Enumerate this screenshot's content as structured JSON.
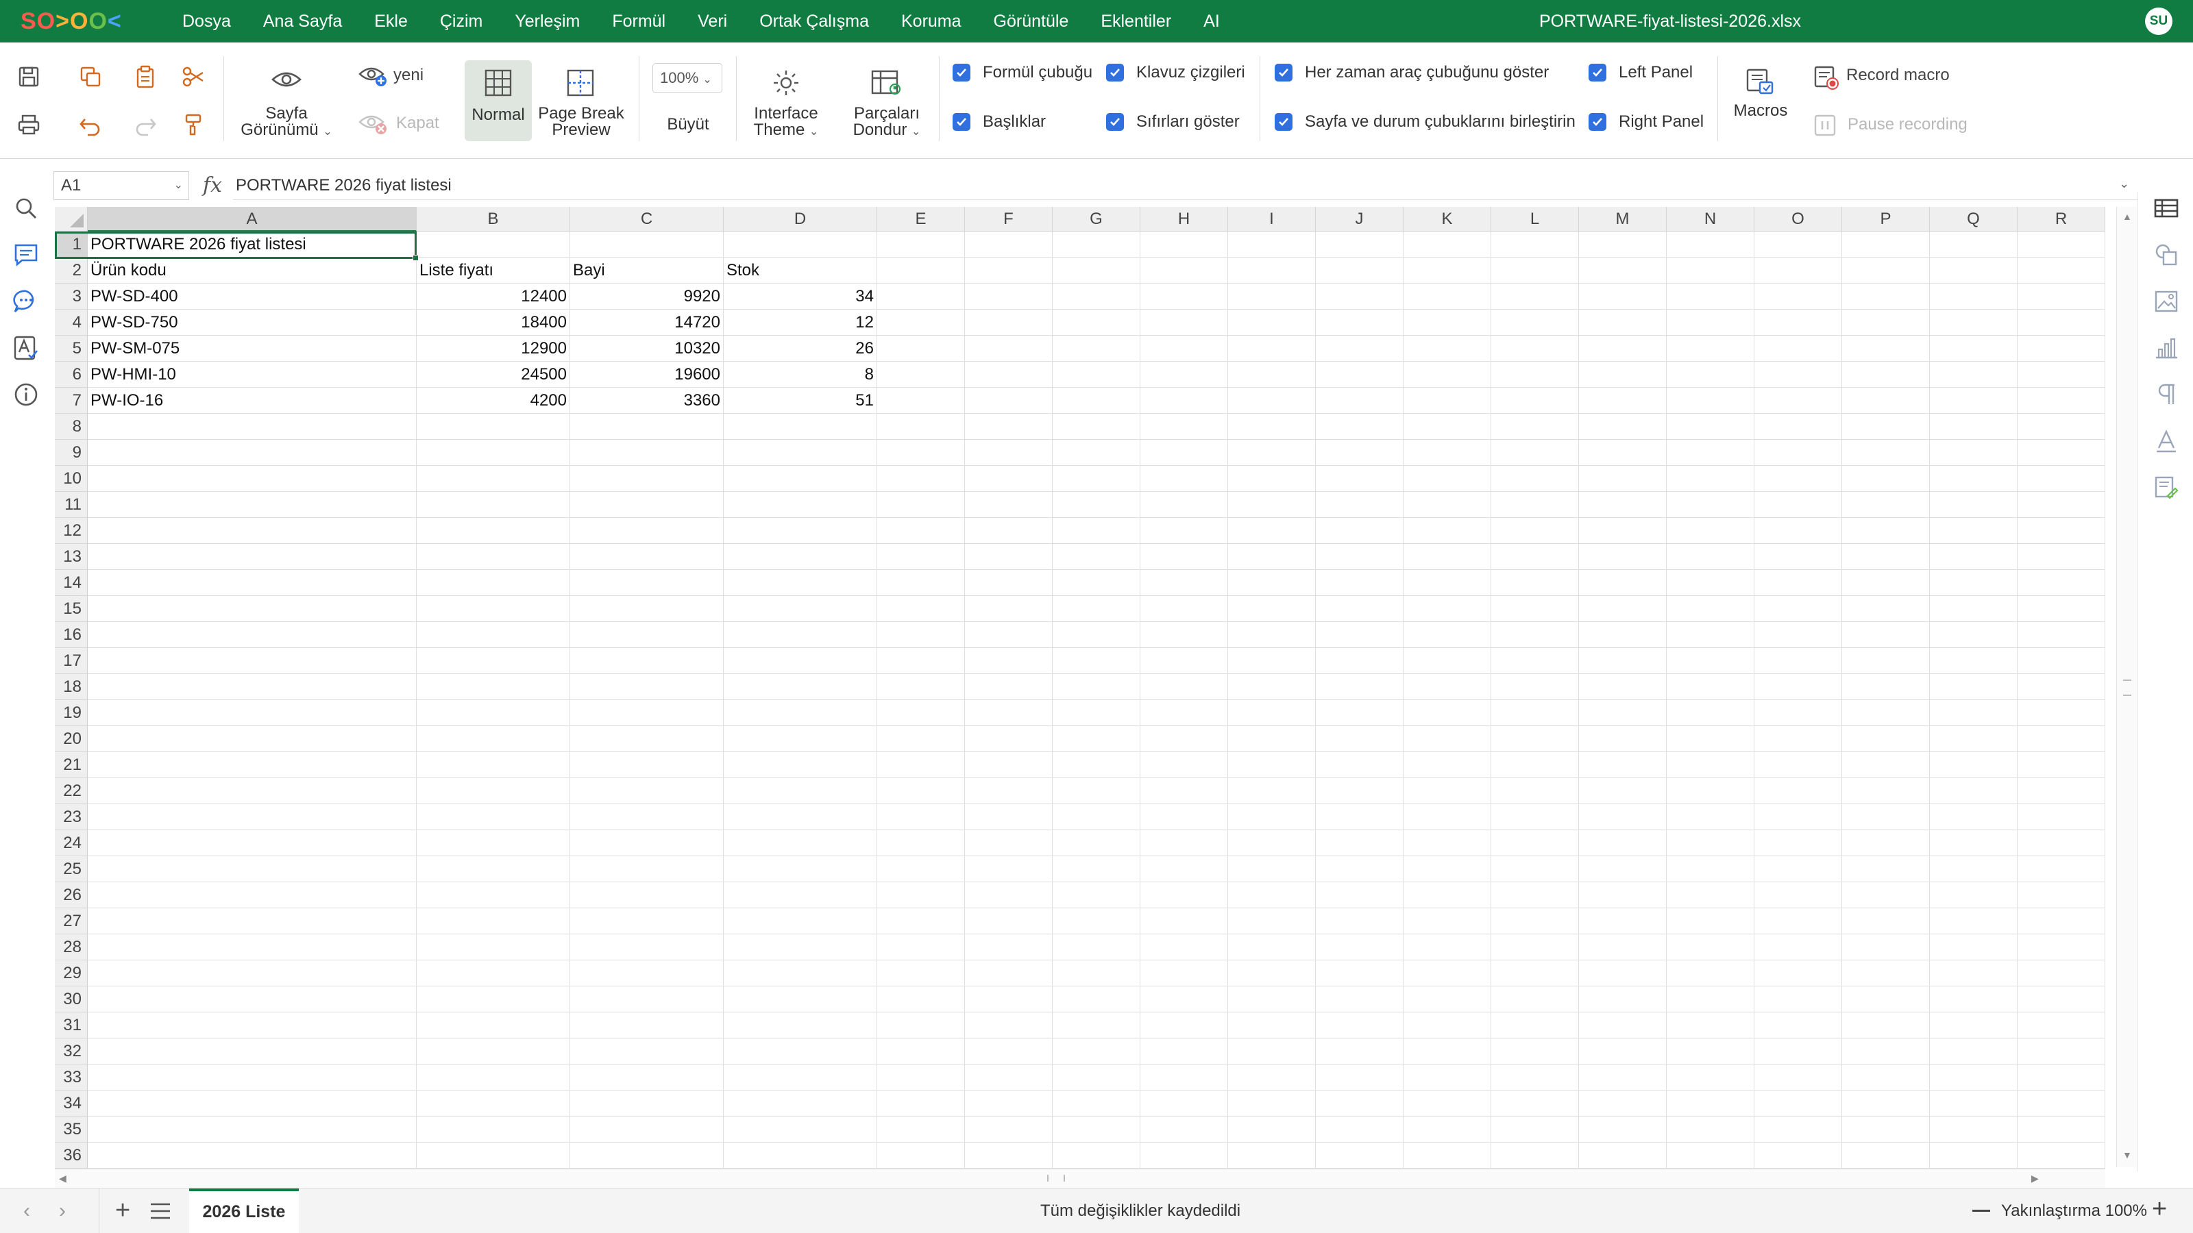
{
  "app": {
    "logo": "SO>OO<",
    "avatar_initials": "SU"
  },
  "window": {
    "title": "PORTWARE-fiyat-listesi-2026.xlsx"
  },
  "menu": [
    "Dosya",
    "Ana Sayfa",
    "Ekle",
    "Çizim",
    "Yerleşim",
    "Formül",
    "Veri",
    "Ortak Çalışma",
    "Koruma",
    "Görüntüle",
    "Eklentiler",
    "AI"
  ],
  "ribbon": {
    "sheet_view_label_1": "Sayfa",
    "sheet_view_label_2": "Görünümü",
    "new_label": "yeni",
    "close_label": "Kapat",
    "normal_label": "Normal",
    "page_break_1": "Page Break",
    "page_break_2": "Preview",
    "zoom_value": "100%",
    "zoom_in_label": "Büyüt",
    "interface_theme_1": "Interface",
    "interface_theme_2": "Theme",
    "freeze_panes_1": "Parçaları",
    "freeze_panes_2": "Dondur",
    "checkboxes": {
      "formula_bar": "Formül çubuğu",
      "headings": "Başlıklar",
      "gridlines": "Klavuz çizgileri",
      "show_zeros": "Sıfırları göster",
      "always_show_toolbar": "Her zaman araç çubuğunu göster",
      "combine_bars": "Sayfa ve durum çubuklarını birleştirin",
      "left_panel": "Left Panel",
      "right_panel": "Right Panel"
    },
    "macros_label": "Macros",
    "record_macro_label": "Record macro",
    "pause_recording_label": "Pause recording"
  },
  "formula_bar": {
    "name_box": "A1",
    "fx": "fx",
    "value": "PORTWARE 2026 fiyat listesi"
  },
  "grid": {
    "columns": [
      "A",
      "B",
      "C",
      "D",
      "E",
      "F",
      "G",
      "H",
      "I",
      "J",
      "K",
      "L",
      "M",
      "N",
      "O",
      "P",
      "Q",
      "R"
    ],
    "row_count": 36,
    "cells": {
      "r1": {
        "a": "PORTWARE 2026 fiyat listesi"
      },
      "r2": {
        "a": "Ürün kodu",
        "b": "Liste fiyatı",
        "c": "Bayi",
        "d": "Stok"
      },
      "r3": {
        "a": "PW-SD-400",
        "b": "12400",
        "c": "9920",
        "d": "34"
      },
      "r4": {
        "a": "PW-SD-750",
        "b": "18400",
        "c": "14720",
        "d": "12"
      },
      "r5": {
        "a": "PW-SM-075",
        "b": "12900",
        "c": "10320",
        "d": "26"
      },
      "r6": {
        "a": "PW-HMI-10",
        "b": "24500",
        "c": "19600",
        "d": "8"
      },
      "r7": {
        "a": "PW-IO-16",
        "b": "4200",
        "c": "3360",
        "d": "51"
      }
    }
  },
  "status": {
    "sheet_tab": "2026 Liste",
    "save_status": "Tüm değişiklikler kaydedildi",
    "zoom_label": "Yakınlaştırma 100%"
  },
  "colors": {
    "brand": "#107c41",
    "checkbox": "#2f6fe0",
    "selection": "#1e7145"
  }
}
